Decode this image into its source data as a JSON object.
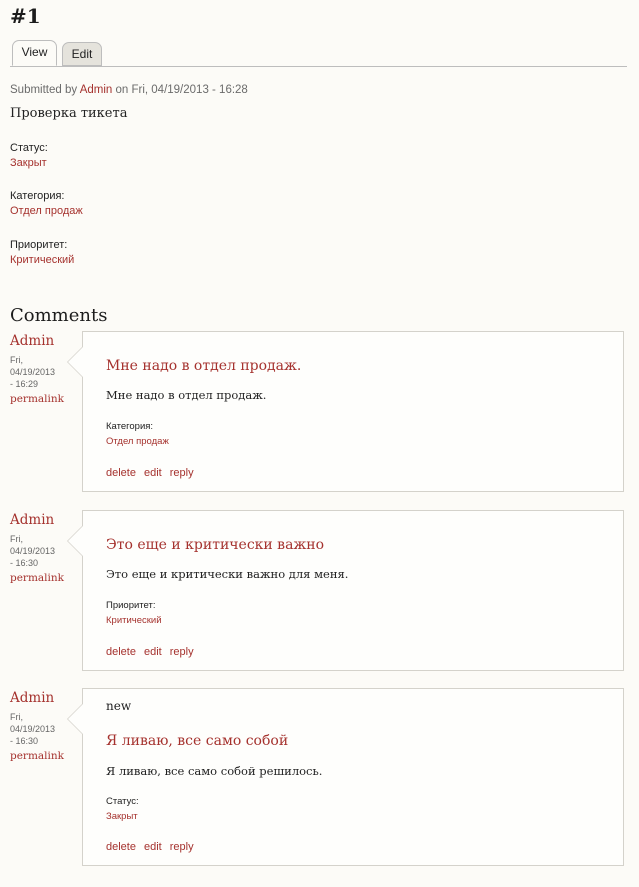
{
  "page": {
    "title": "#1"
  },
  "tabs": {
    "view": "View",
    "edit": "Edit"
  },
  "submitted": {
    "prefix": "Submitted by ",
    "author": "Admin",
    "suffix": " on Fri, 04/19/2013 - 16:28"
  },
  "node": {
    "body": "Проверка тикета",
    "fields": [
      {
        "label": "Статус:",
        "value": "Закрыт"
      },
      {
        "label": "Категория:",
        "value": "Отдел продаж"
      },
      {
        "label": "Приоритет:",
        "value": "Критический"
      }
    ]
  },
  "comments_title": "Comments",
  "comments": [
    {
      "author": "Admin",
      "date_line1": "Fri,",
      "date_line2": "04/19/2013",
      "date_line3": "- 16:29",
      "permalink": "permalink",
      "new": "",
      "subject": "Мне надо в отдел продаж.",
      "text": "Мне надо в отдел продаж.",
      "field_label": "Категория:",
      "field_value": "Отдел продаж",
      "links": {
        "delete": "delete",
        "edit": "edit",
        "reply": "reply"
      }
    },
    {
      "author": "Admin",
      "date_line1": "Fri,",
      "date_line2": "04/19/2013",
      "date_line3": "- 16:30",
      "permalink": "permalink",
      "new": "",
      "subject": "Это еще и критически важно",
      "text": "Это еще и критически важно для меня.",
      "field_label": "Приоритет:",
      "field_value": "Критический",
      "links": {
        "delete": "delete",
        "edit": "edit",
        "reply": "reply"
      }
    },
    {
      "author": "Admin",
      "date_line1": "Fri,",
      "date_line2": "04/19/2013",
      "date_line3": "- 16:30",
      "permalink": "permalink",
      "new": "new",
      "subject": "Я ливаю, все само собой",
      "text": "Я ливаю, все само собой решилось.",
      "field_label": "Статус:",
      "field_value": "Закрыт",
      "links": {
        "delete": "delete",
        "edit": "edit",
        "reply": "reply"
      }
    }
  ]
}
